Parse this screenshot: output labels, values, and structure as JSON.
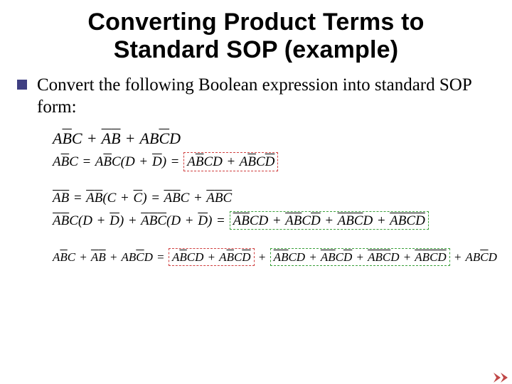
{
  "title_line1": "Converting Product Terms to",
  "title_line2": "Standard SOP (example)",
  "body_text": "Convert the following Boolean expression into standard SOP form:",
  "math": {
    "main_expr_html": "A<span class='ov'>B</span>C <span class='op'>+</span> <span class='ov'>A</span><span class='ov'>B</span> <span class='op'>+</span> AB<span class='ov'>C</span>D",
    "step1_html": "A<span class='ov'>B</span>C <span class='op'>=</span> A<span class='ov'>B</span>C(D <span class='op'>+</span> <span class='ov'>D</span>) <span class='op'>=</span> <span class='boxed-red'>A<span class='ov'>B</span>CD <span class='op'>+</span> A<span class='ov'>B</span>C<span class='ov'>D</span></span>",
    "step2a_html": "<span class='ov'>A</span><span class='ov'>B</span> <span class='op'>=</span> <span class='ov'>A</span><span class='ov'>B</span>(C <span class='op'>+</span> <span class='ov'>C</span>) <span class='op'>=</span> <span class='ov'>A</span><span class='ov'>B</span>C <span class='op'>+</span> <span class='ov'>A</span><span class='ov'>B</span><span class='ov'>C</span>",
    "step2b_html": "<span class='ov'>A</span><span class='ov'>B</span>C(D <span class='op'>+</span> <span class='ov'>D</span>) <span class='op'>+</span> <span class='ov'>A</span><span class='ov'>B</span><span class='ov'>C</span>(D <span class='op'>+</span> <span class='ov'>D</span>) <span class='op'>=</span> <span class='boxed-green'><span class='ov'>A</span><span class='ov'>B</span>CD <span class='op'>+</span> <span class='ov'>A</span><span class='ov'>B</span>C<span class='ov'>D</span> <span class='op'>+</span> <span class='ov'>A</span><span class='ov'>B</span><span class='ov'>C</span>D <span class='op'>+</span> <span class='ov'>A</span><span class='ov'>B</span><span class='ov'>C</span><span class='ov'>D</span></span>",
    "final_html": "A<span class='ov'>B</span>C <span class='op'>+</span> <span class='ov'>A</span><span class='ov'>B</span> <span class='op'>+</span> AB<span class='ov'>C</span>D <span class='op'>=</span> <span class='boxed-red'>A<span class='ov'>B</span>CD <span class='op'>+</span> A<span class='ov'>B</span>C<span class='ov'>D</span></span> <span class='op'>+</span> <span class='boxed-green'><span class='ov'>A</span><span class='ov'>B</span>CD <span class='op'>+</span> <span class='ov'>A</span><span class='ov'>B</span>C<span class='ov'>D</span> <span class='op'>+</span> <span class='ov'>A</span><span class='ov'>B</span><span class='ov'>C</span>D <span class='op'>+</span> <span class='ov'>A</span><span class='ov'>B</span><span class='ov'>C</span><span class='ov'>D</span></span> <span class='op'>+</span> AB<span class='ov'>C</span>D"
  },
  "colors": {
    "bullet": "#3f3f82",
    "red_dash": "#d04040",
    "green_dash": "#3aa03a",
    "arrow": "#c04848"
  }
}
